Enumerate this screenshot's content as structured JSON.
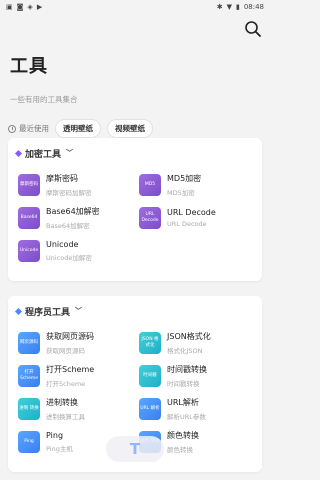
{
  "statusbar": {
    "time": "08:48"
  },
  "page": {
    "title": "工具",
    "subtitle": "一些有用的工具集合"
  },
  "recent": {
    "label": "最近使用",
    "chips": [
      "透明壁纸",
      "视频壁纸"
    ]
  },
  "sections": [
    {
      "title": "加密工具",
      "accent": "#8a5cf6",
      "tools": [
        {
          "icon_text": "摩斯密码",
          "name": "摩斯密码",
          "desc": "摩斯密码加解密",
          "color": "purple"
        },
        {
          "icon_text": "MD5",
          "name": "MD5加密",
          "desc": "MD5加密",
          "color": "purple"
        },
        {
          "icon_text": "Base64",
          "name": "Base64加解密",
          "desc": "Base64加解密",
          "color": "purple"
        },
        {
          "icon_text": "URL Decode",
          "name": "URL Decode",
          "desc": "URL Decode",
          "color": "purple"
        },
        {
          "icon_text": "Unicode",
          "name": "Unicode",
          "desc": "Unicode加解密",
          "color": "purple"
        }
      ]
    },
    {
      "title": "程序员工具",
      "accent": "#4a8cf7",
      "tools": [
        {
          "icon_text": "网页源码",
          "name": "获取网页源码",
          "desc": "获取网页源码",
          "color": "blue"
        },
        {
          "icon_text": "JSON 格式化",
          "name": "JSON格式化",
          "desc": "格式化JSON",
          "color": "cyan"
        },
        {
          "icon_text": "打开 Scheme",
          "name": "打开Scheme",
          "desc": "打开Scheme",
          "color": "blue"
        },
        {
          "icon_text": "时间戳",
          "name": "时间戳转换",
          "desc": "时间戳转换",
          "color": "cyan"
        },
        {
          "icon_text": "进制 转换",
          "name": "进制转换",
          "desc": "进制换算工具",
          "color": "cyan"
        },
        {
          "icon_text": "URL 解析",
          "name": "URL解析",
          "desc": "解析URL参数",
          "color": "blue"
        },
        {
          "icon_text": "Ping",
          "name": "Ping",
          "desc": "Ping主机",
          "color": "blue"
        },
        {
          "icon_text": "颜色 转换",
          "name": "颜色转换",
          "desc": "颜色转换",
          "color": "blue"
        }
      ]
    }
  ],
  "fab": {
    "label": "T"
  }
}
